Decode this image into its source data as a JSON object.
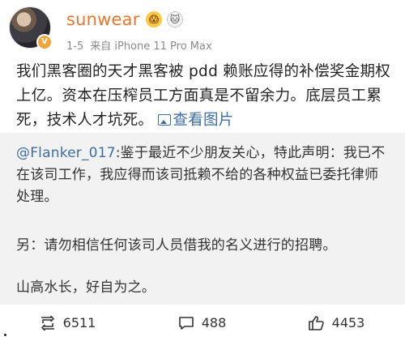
{
  "user": {
    "name": "sunwear",
    "emoji_1": "😱",
    "emoji_2": "🐱",
    "date": "1-5",
    "source": "来自 iPhone 11 Pro Max"
  },
  "post": {
    "text": "我们黑客圈的天才黑客被 pdd 赖账应得的补偿奖金期权上亿。资本在压榨员工方面真是不留余力。底层员工累死，技术人才坑死。",
    "view_image": "查看图片"
  },
  "repost": {
    "mention": "@Flanker_017",
    "text": ":鉴于最近不少朋友关心，特此声明：我已不在该司工作，我应得而该司抵赖不给的各种权益已委托律师处理。",
    "para2": "另：请勿相信任何该司人员借我的名义进行的招聘。",
    "para3": "山高水长，好自为之。"
  },
  "actions": {
    "repost_count": "6511",
    "comment_count": "488",
    "like_count": "4453"
  },
  "colors": {
    "username": "#e8762c",
    "link": "#3d6ea3",
    "repost_bg": "#f2f2f2"
  }
}
